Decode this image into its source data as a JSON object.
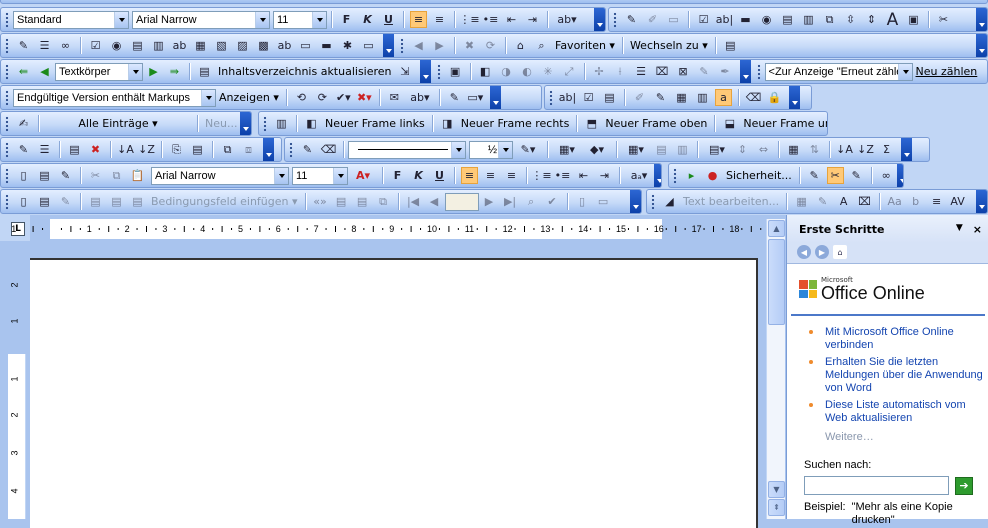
{
  "toolbars": {
    "format": {
      "style": "Standard",
      "font": "Arial Narrow",
      "size": "11"
    },
    "web": {
      "favorites": "Favoriten ▾",
      "goto": "Wechseln zu ▾"
    },
    "outline": {
      "level": "Textkörper",
      "toc": "Inhaltsverzeichnis aktualisieren",
      "display": "<Zur Anzeige \"Erneut zähle",
      "renumber": "Neu zählen"
    },
    "review": {
      "markup": "Endgültige Version enthält Markups",
      "show": "Anzeigen ▾"
    },
    "autotext": {
      "all": "Alle Einträge ▾",
      "new": "Neu..."
    },
    "frames": {
      "left": "Neuer Frame links",
      "right": "Neuer Frame rechts",
      "top": "Neuer Frame oben",
      "bottom": "Neuer Frame unten"
    },
    "tables": {
      "weight": "½"
    },
    "format2": {
      "font": "Arial Narrow",
      "size": "11"
    },
    "macro": {
      "security": "Sicherheit..."
    },
    "mailmerge": {
      "insert_field": "Bedingungsfeld einfügen ▾"
    },
    "wordart": {
      "edit": "Text bearbeiten..."
    }
  },
  "ruler": {
    "tab_selector": "L",
    "h_numbers": [
      "1",
      "1",
      "2",
      "3",
      "4",
      "5",
      "6",
      "7",
      "8",
      "9",
      "10",
      "11",
      "12",
      "13",
      "14",
      "15",
      "16",
      "17",
      "18"
    ],
    "v_numbers": [
      "2",
      "1",
      "1",
      "2",
      "3",
      "4"
    ]
  },
  "task_pane": {
    "title": "Erste Schritte",
    "close": "×",
    "menu": "▼",
    "logo_small": "Microsoft",
    "logo_big": "Office Online",
    "links": [
      "Mit Microsoft Office Online verbinden",
      "Erhalten Sie die letzten Meldungen über die Anwendung von Word",
      "Diese Liste automatisch vom Web aktualisieren"
    ],
    "more": "Weitere…",
    "search_label": "Suchen nach:",
    "search_value": "",
    "example_label": "Beispiel:",
    "example_text": "\"Mehr als eine Kopie drucken\""
  },
  "colors": {
    "accent": "#0b3fa8",
    "highlight": "#ffc977",
    "link": "#1445b0",
    "bullet": "#ef8b2d"
  }
}
